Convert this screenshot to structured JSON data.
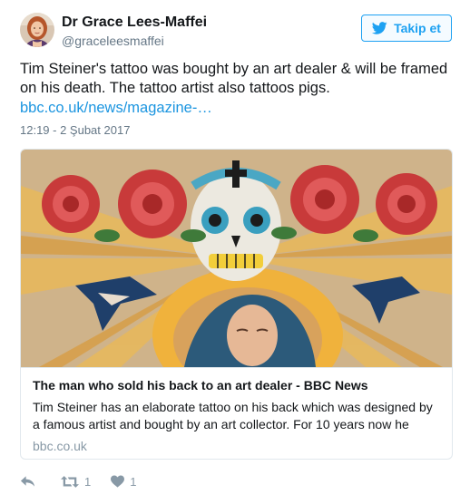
{
  "user": {
    "name": "Dr Grace Lees-Maffei",
    "handle": "@graceleesmaffei",
    "avatar_icon": "profile-photo"
  },
  "follow_button": {
    "label": "Takip et",
    "icon": "twitter-bird-icon",
    "color": "#1da1f2"
  },
  "tweet": {
    "text": "Tim Steiner's tattoo was bought by an art dealer & will be framed on his death. The tattoo artist also tattoos pigs.",
    "link": "bbc.co.uk/news/magazine-…",
    "timestamp": "12:19 - 2 Şubat 2017",
    "link_color": "#1b95e0"
  },
  "card": {
    "image_icon": "tattoo-back-photo",
    "title": "The man who sold his back to an art dealer - BBC News",
    "description": "Tim Steiner has an elaborate tattoo on his back which was designed by a famous artist and bought by an art collector. For 10 years now he",
    "domain": "bbc.co.uk"
  },
  "actions": {
    "reply_icon": "reply-icon",
    "retweet_icon": "retweet-icon",
    "retweet_count": "1",
    "like_icon": "heart-icon",
    "like_count": "1"
  }
}
